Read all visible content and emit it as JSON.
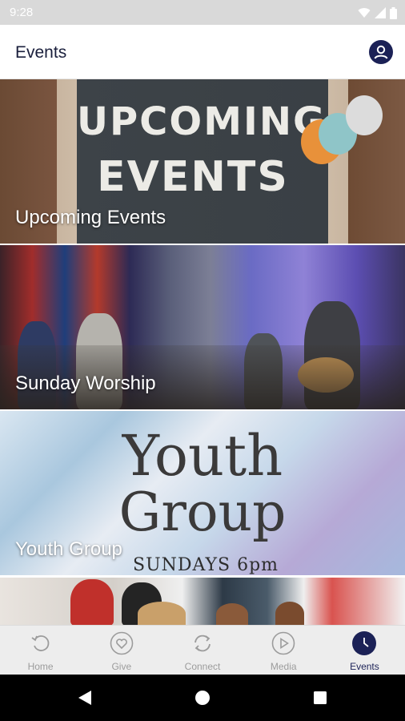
{
  "status_bar": {
    "time": "9:28"
  },
  "app_bar": {
    "title": "Events",
    "profile_icon": "account-circle-icon"
  },
  "events": [
    {
      "label": "Upcoming Events",
      "image_text": [
        "UPCOMING",
        "EVENTS"
      ]
    },
    {
      "label": "Sunday Worship"
    },
    {
      "label": "Youth Group",
      "image_text": [
        "Youth",
        "Group"
      ],
      "image_subtext": "SUNDAYS 6pm"
    },
    {
      "label": ""
    }
  ],
  "bottom_nav": {
    "items": [
      {
        "label": "Home",
        "icon": "history-icon"
      },
      {
        "label": "Give",
        "icon": "heart-icon"
      },
      {
        "label": "Connect",
        "icon": "refresh-icon"
      },
      {
        "label": "Media",
        "icon": "play-icon"
      },
      {
        "label": "Events",
        "icon": "clock-icon",
        "active": true
      }
    ]
  },
  "colors": {
    "primary": "#1b2156",
    "inactive": "#9c9c9c",
    "status_bar": "#d9d9d9"
  }
}
